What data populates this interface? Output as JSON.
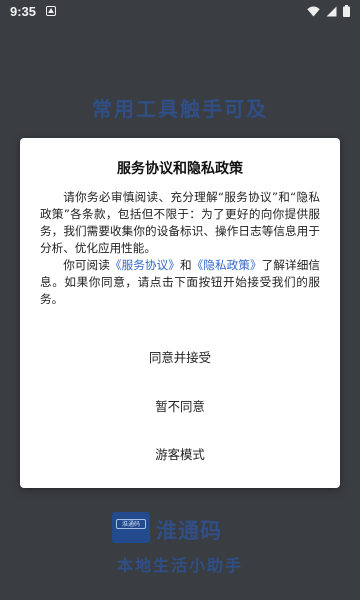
{
  "status_bar": {
    "time": "9:35",
    "icons": [
      "notification-icon",
      "wifi-icon",
      "signal-icon",
      "battery-icon"
    ]
  },
  "background": {
    "headline": "常用工具触手可及",
    "brand": {
      "logo_text": "淮通码",
      "name": "淮通码",
      "subtitle": "本地生活小助手"
    }
  },
  "dialog": {
    "title": "服务协议和隐私政策",
    "paragraph1": "请你务必审慎阅读、充分理解“服务协议”和“隐私政策”各条款，包括但不限于：为了更好的向你提供服务，我们需要收集你的设备标识、操作日志等信息用于分析、优化应用性能。",
    "paragraph2": {
      "prefix": "你可阅读",
      "service_link": "《服务协议》",
      "middle": "和",
      "privacy_link": "《隐私政策》",
      "suffix": "了解详细信息。如果你同意，请点击下面按钮开始接受我们的服务。"
    },
    "agree_label": "同意并接受",
    "disagree_label": "暂不同意",
    "guest_label": "游客模式"
  },
  "colors": {
    "background": "#3a3d42",
    "accent": "#2f4f86",
    "link": "#2f66c9"
  }
}
